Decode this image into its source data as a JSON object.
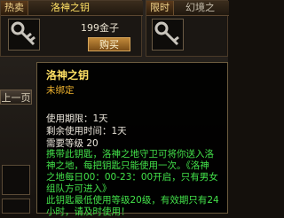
{
  "shop": {
    "item1": {
      "tag": "热卖",
      "name": "洛神之钥",
      "price": "199金子",
      "buy_label": "购买"
    },
    "item2": {
      "tag": "限时",
      "name": "幻境之"
    },
    "prev_page": "上一页"
  },
  "tooltip": {
    "title": "洛神之钥",
    "bind_status": "未绑定",
    "stats": [
      "使用期限：1天",
      "剩余使用时间：1天",
      "需要等级 20"
    ],
    "description": [
      "携带此钥匙，洛神之地守卫可将你送入洛",
      "神之地，每把钥匙只能使用一次。《洛神",
      "之地每日00：00-23：00开启，只有男女",
      "组队方可进入》",
      "此钥匙最低使用等级20级，有效期只有24",
      "小时，请及时使用！"
    ]
  }
}
